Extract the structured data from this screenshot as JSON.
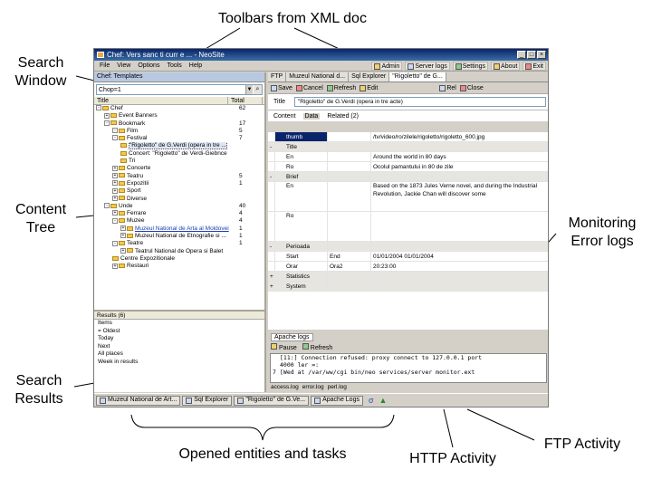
{
  "captions": {
    "toolbars": "Toolbars from XML doc",
    "search_window": "Search Window",
    "content_tree": "Content Tree",
    "monitoring": "Monitoring Error logs",
    "search_results": "Search Results",
    "opened_entities": "Opened entities and tasks",
    "http_activity": "HTTP Activity",
    "ftp_activity": "FTP Activity"
  },
  "window": {
    "title": "Chef: Vers sanc ti curr e ... - NeoSite",
    "controls": [
      "_",
      "□",
      "×"
    ]
  },
  "menu": [
    "File",
    "View",
    "Options",
    "Tools",
    "Help"
  ],
  "top_toolbar": [
    {
      "label": "Admin",
      "icon": "admin-icon"
    },
    {
      "label": "Server logs",
      "icon": "server-logs-icon"
    },
    {
      "label": "Settings",
      "icon": "settings-icon"
    },
    {
      "label": "About",
      "icon": "about-icon"
    },
    {
      "label": "Exit",
      "icon": "exit-icon"
    }
  ],
  "left": {
    "header": "Chef: Templates",
    "search_value": "Chop=1",
    "columns": [
      "Title",
      "Total"
    ],
    "tree": [
      {
        "label": "Chef",
        "count": "62",
        "level": 0,
        "exp": "-"
      },
      {
        "label": "Event Banners",
        "count": "",
        "level": 1,
        "exp": "+"
      },
      {
        "label": "Bookmark",
        "count": "17",
        "level": 1,
        "exp": "-"
      },
      {
        "label": "Film",
        "count": "5",
        "level": 2,
        "exp": "-"
      },
      {
        "label": "Festival",
        "count": "7",
        "level": 2,
        "exp": "-"
      },
      {
        "label": "\"Rigoletto\" de G.Verdi (opera in tre ...",
        "count": "",
        "level": 3,
        "exp": "",
        "selected": true
      },
      {
        "label": "Concert: \"Rigoletto\" de Verdi-Giebnce",
        "count": "",
        "level": 3,
        "exp": ""
      },
      {
        "label": "Tri",
        "count": "",
        "level": 3,
        "exp": ""
      },
      {
        "label": "Concerte",
        "count": "",
        "level": 2,
        "exp": "+"
      },
      {
        "label": "Teatru",
        "count": "5",
        "level": 2,
        "exp": "+"
      },
      {
        "label": "Expozitii",
        "count": "1",
        "level": 2,
        "exp": "+"
      },
      {
        "label": "Sport",
        "count": "",
        "level": 2,
        "exp": "+"
      },
      {
        "label": "Diverse",
        "count": "",
        "level": 2,
        "exp": "+"
      },
      {
        "label": "Unde",
        "count": "40",
        "level": 1,
        "exp": "-"
      },
      {
        "label": "Ferrare",
        "count": "4",
        "level": 2,
        "exp": "+"
      },
      {
        "label": "Muzee",
        "count": "4",
        "level": 2,
        "exp": "-"
      },
      {
        "label": "Muzeul National de Arta al Moldovei",
        "count": "1",
        "level": 3,
        "exp": "+",
        "link": true
      },
      {
        "label": "Muzeul National de Etnografie si ...",
        "count": "1",
        "level": 3,
        "exp": "+"
      },
      {
        "label": "Teatre",
        "count": "1",
        "level": 2,
        "exp": "-"
      },
      {
        "label": "Teatrul National de Opera si Balet",
        "count": "",
        "level": 3,
        "exp": "+"
      },
      {
        "label": "Centre Expozitionale",
        "count": "",
        "level": 2,
        "exp": ""
      },
      {
        "label": "Restauri",
        "count": "",
        "level": 2,
        "exp": "+"
      }
    ],
    "results_header": "Results (6)",
    "results": [
      "Items",
      "= Oldest",
      "Today",
      "Next",
      "All places",
      "Week in results"
    ]
  },
  "right": {
    "tabs": [
      "FTP",
      "Muzeul National d...",
      "Sql Explorer",
      "\"Rigoletto\" de G..."
    ],
    "toolbar": [
      "Save",
      "Cancel",
      "Refresh",
      "Edit",
      "Rel",
      "Close"
    ],
    "title_label": "Title",
    "title_value": "\"Rigoletto\" de G.Verdi (opera in tre acte)",
    "subtabs": [
      "Content",
      "Data",
      "Related (2)"
    ],
    "grid": [
      {
        "type": "hl",
        "c1": "thumb",
        "c2": "",
        "c3": "/tv/video/ro/zilele/rigoletto/rigoletto_600.jpg"
      },
      {
        "type": "sec",
        "c0": "-",
        "c1": "Title",
        "c2": "",
        "c3": ""
      },
      {
        "type": "row",
        "c1": "En",
        "c2": "",
        "c3": "Around the world in 80 days"
      },
      {
        "type": "row",
        "c1": "Ro",
        "c2": "",
        "c3": "Ocolul pamantului in 80 de zile"
      },
      {
        "type": "sec",
        "c0": "-",
        "c1": "Brief",
        "c2": "",
        "c3": ""
      },
      {
        "type": "tall",
        "c1": "En",
        "c2": "",
        "c3": "Based on the 1873 Jules Verne novel, and during the Industrial Revolution, Jackie Chan will discover some"
      },
      {
        "type": "tall",
        "c1": "Ro",
        "c2": "",
        "c3": ""
      },
      {
        "type": "sec",
        "c0": "-",
        "c1": "Perioada",
        "c2": "",
        "c3": ""
      },
      {
        "type": "row",
        "c1": "Start",
        "c2": "End",
        "c3": "01/01/2004    01/01/2004"
      },
      {
        "type": "row",
        "c1": "Orar",
        "c2": "Ora2",
        "c3": "20:23:00"
      },
      {
        "type": "sec",
        "c0": "+",
        "c1": "Statistics",
        "c2": "",
        "c3": ""
      },
      {
        "type": "sec",
        "c0": "+",
        "c1": "System",
        "c2": "",
        "c3": ""
      }
    ],
    "log_tab": "Apache logs",
    "log_toolbar": [
      "Pause",
      "Refresh"
    ],
    "log_lines": [
      "[11:] Connection refused: proxy connect to 127.0.0.1 port",
      "4000 ler =:",
      "[Wed at /var/ww/cgi bin/neo services/server monitor.ext"
    ],
    "log_line_numbers": [
      "",
      "",
      "7"
    ],
    "log_bottom": [
      "access.log",
      "error.log",
      "perl.log"
    ]
  },
  "taskbar": {
    "tasks": [
      "Muzeul National de Art...",
      "Sql Explorer",
      "\"Rigoletto\" de G.Ve...",
      "Apache Logs"
    ],
    "tray_icons": [
      "http-activity-icon",
      "ftp-activity-icon"
    ]
  }
}
